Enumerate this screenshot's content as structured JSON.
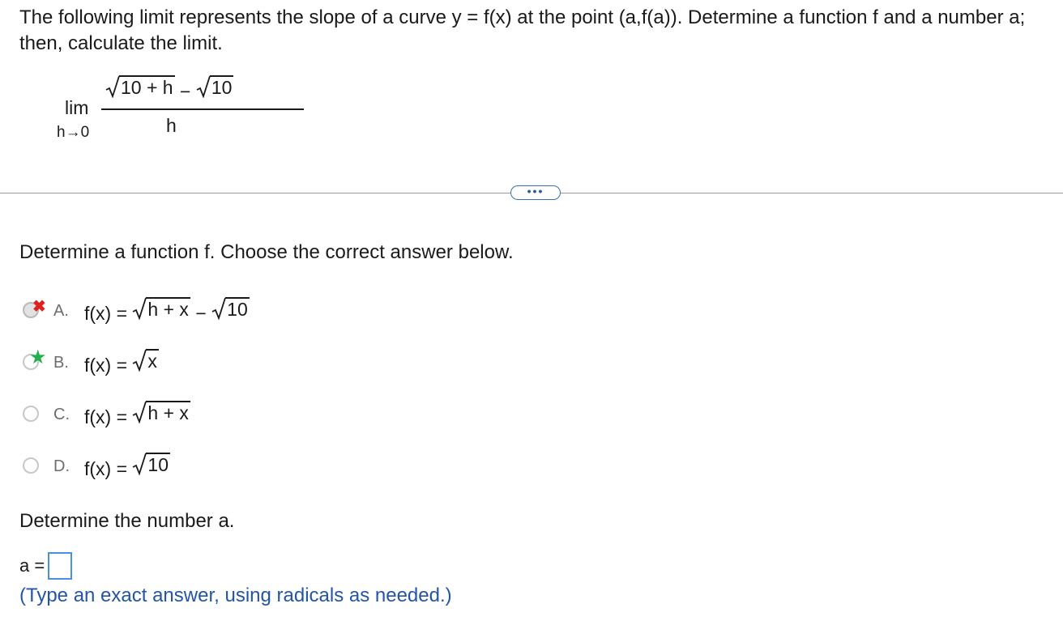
{
  "question": {
    "text": "The following limit represents the slope of a curve y = f(x) at the point (a,f(a)). Determine a function f and a number a; then, calculate the limit."
  },
  "limit": {
    "lim": "lim",
    "sub": "h→0",
    "num_radicand1": "10 + h",
    "num_minus": " − ",
    "num_radicand2": "10",
    "den": "h"
  },
  "more_button": {
    "label": "•••"
  },
  "part1": {
    "prompt": "Determine a function f. Choose the correct answer below.",
    "options": [
      {
        "letter": "A.",
        "lhs": "f(x) = ",
        "radicand": "h + x",
        "tail": " − ",
        "radicand2": "10",
        "state": "incorrect",
        "mark": "✖"
      },
      {
        "letter": "B.",
        "lhs": "f(x) = ",
        "radicand": "x",
        "state": "correct",
        "mark": "★"
      },
      {
        "letter": "C.",
        "lhs": "f(x) = ",
        "radicand": "h + x",
        "state": "none"
      },
      {
        "letter": "D.",
        "lhs": "f(x) = ",
        "radicand": "10",
        "state": "none"
      }
    ]
  },
  "part2": {
    "prompt": "Determine the number a.",
    "label": "a =",
    "value": "",
    "hint": "(Type an exact answer, using radicals as needed.)"
  },
  "colors": {
    "incorrect": "#e02020",
    "correct": "#22b04a",
    "link": "#2455a4",
    "input_border": "#4a8fe0"
  }
}
